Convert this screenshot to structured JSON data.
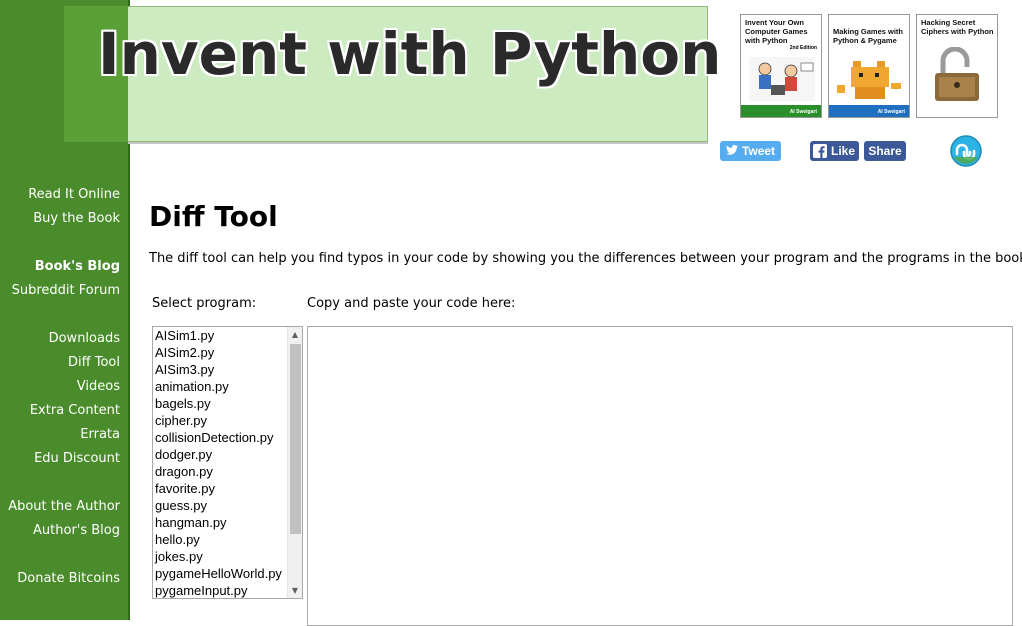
{
  "site": {
    "title": "Invent with Python"
  },
  "books": [
    {
      "title": "Invent Your Own Computer Games with Python",
      "edition": "2nd Edition",
      "author": "Al Sweigart",
      "bar_color": "#2a8f2a"
    },
    {
      "title": "Making Games with Python & Pygame",
      "author": "Al Sweigart",
      "bar_color": "#d42020"
    },
    {
      "title": "Hacking Secret Ciphers with Python",
      "author": "Al Sweigart",
      "bar_color": "#1f6fc0"
    }
  ],
  "social": {
    "tweet": "Tweet",
    "like": "Like",
    "share": "Share"
  },
  "nav": {
    "read_online": "Read It Online",
    "buy_book": "Buy the Book",
    "books_blog": "Book's Blog",
    "subreddit": "Subreddit Forum",
    "downloads": "Downloads",
    "diff_tool": "Diff Tool",
    "videos": "Videos",
    "extra_content": "Extra Content",
    "errata": "Errata",
    "edu_discount": "Edu Discount",
    "about_author": "About the Author",
    "authors_blog": "Author's Blog",
    "donate_bitcoins": "Donate Bitcoins"
  },
  "main": {
    "title": "Diff Tool",
    "intro": "The diff tool can help you find typos in your code by showing you the differences between your program and the programs in the book.",
    "select_label": "Select program:",
    "paste_label": "Copy and paste your code here:",
    "code_value": "",
    "programs": [
      "AISim1.py",
      "AISim2.py",
      "AISim3.py",
      "animation.py",
      "bagels.py",
      "cipher.py",
      "collisionDetection.py",
      "dodger.py",
      "dragon.py",
      "favorite.py",
      "guess.py",
      "hangman.py",
      "hello.py",
      "jokes.py",
      "pygameHelloWorld.py",
      "pygameInput.py"
    ]
  },
  "colors": {
    "sidebar": "#4a8c2c",
    "banner": "#cdebc0",
    "twitter": "#55acee",
    "facebook": "#3b5998",
    "stumbleupon": "#2cb3e6"
  }
}
